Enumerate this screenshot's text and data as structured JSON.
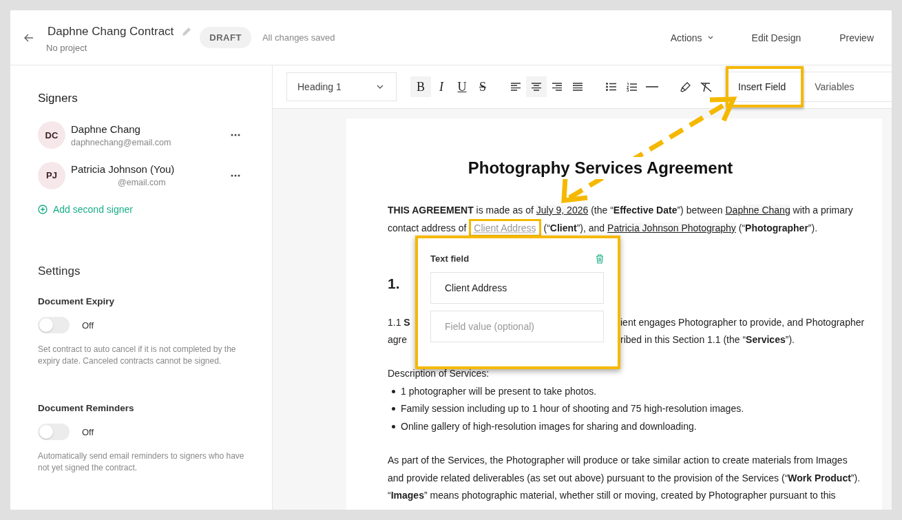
{
  "header": {
    "title": "Daphne Chang Contract",
    "subtitle": "No project",
    "status": "DRAFT",
    "save_status": "All changes saved",
    "menu": [
      {
        "label": "Actions",
        "kind": "dropdown"
      },
      {
        "label": "Edit Design",
        "kind": "link"
      },
      {
        "label": "Preview",
        "kind": "link"
      }
    ]
  },
  "sidebar": {
    "signers_title": "Signers",
    "signers": [
      {
        "initials": "DC",
        "name": "Daphne Chang",
        "email": "daphnechang@email.com"
      },
      {
        "initials": "PJ",
        "name": "Patricia Johnson (You)",
        "email": "@email.com"
      }
    ],
    "add_signer": "Add second signer",
    "settings_title": "Settings",
    "settings": [
      {
        "label": "Document Expiry",
        "on": false,
        "state_text": "Off",
        "description": "Set contract to auto cancel if it is not completed by the expiry date. Canceled contracts cannot be signed."
      },
      {
        "label": "Document Reminders",
        "on": false,
        "state_text": "Off",
        "description": "Automatically send email reminders to signers who have not yet signed the contract."
      }
    ]
  },
  "toolbar": {
    "style_select": "Heading 1",
    "groups": [
      [
        {
          "kind": "bold",
          "label": "B",
          "selected": true
        },
        {
          "kind": "italic",
          "label": "I",
          "selected": false
        },
        {
          "kind": "underline",
          "label": "U",
          "selected": false
        },
        {
          "kind": "strike",
          "label": "S",
          "selected": false
        }
      ],
      [
        {
          "kind": "align-left",
          "selected": false
        },
        {
          "kind": "align-center",
          "selected": true
        },
        {
          "kind": "align-right",
          "selected": false
        },
        {
          "kind": "justify",
          "selected": false
        }
      ],
      [
        {
          "kind": "bullets",
          "selected": false
        },
        {
          "kind": "numbers",
          "selected": false
        },
        {
          "kind": "rule",
          "selected": false
        }
      ],
      [
        {
          "kind": "highlight",
          "selected": false
        },
        {
          "kind": "clear-format",
          "selected": false
        }
      ]
    ],
    "tabs": [
      {
        "label": "Insert Field",
        "selected": true
      },
      {
        "label": "Variables",
        "selected": false
      }
    ]
  },
  "document": {
    "title": "Photography Services Agreement",
    "intro": [
      {
        "kind": "text",
        "s": "**THIS AGREEMENT** is made as of "
      },
      {
        "kind": "variable",
        "s": "July 9, 2026"
      },
      {
        "kind": "text",
        "s": " (the “**Effective Date**”) between "
      },
      {
        "kind": "variable",
        "s": "Daphne Chang"
      },
      {
        "kind": "text",
        "s": " with a primary contact address of "
      },
      {
        "kind": "field",
        "s": "Client Address",
        "selected": true
      },
      {
        "kind": "text",
        "s": " (“**Client**”), and "
      },
      {
        "kind": "variable",
        "s": "Patricia Johnson Photography"
      },
      {
        "kind": "text",
        "s": " (“**Photographer**”)."
      }
    ],
    "section_heading": "1.",
    "section_lines": [
      {
        "left": "1.1 **S**",
        "right": "ient engages Photographer to provide, and Photographer"
      },
      {
        "left": "agre",
        "right": "ribed in this Section 1.1 (the “**Services**”)."
      }
    ],
    "list_title": "Description of Services:",
    "bullets": [
      "1 photographer will be present to take photos.",
      "Family session including up to 1 hour of shooting and 75 high-resolution images.",
      "Online gallery of high-resolution images for sharing and downloading."
    ],
    "closing_lines": [
      "As part of the Services, the Photographer will produce or take similar action to create materials from Images",
      "and provide related deliverables (as set out above) pursuant to the provision of the Services (“**Work Product**”).",
      "“**Images**” means photographic material, whether still or moving, created by Photographer pursuant to this"
    ]
  },
  "popup": {
    "title": "Text field",
    "name_value": "Client Address",
    "value_placeholder": "Field value (optional)"
  }
}
